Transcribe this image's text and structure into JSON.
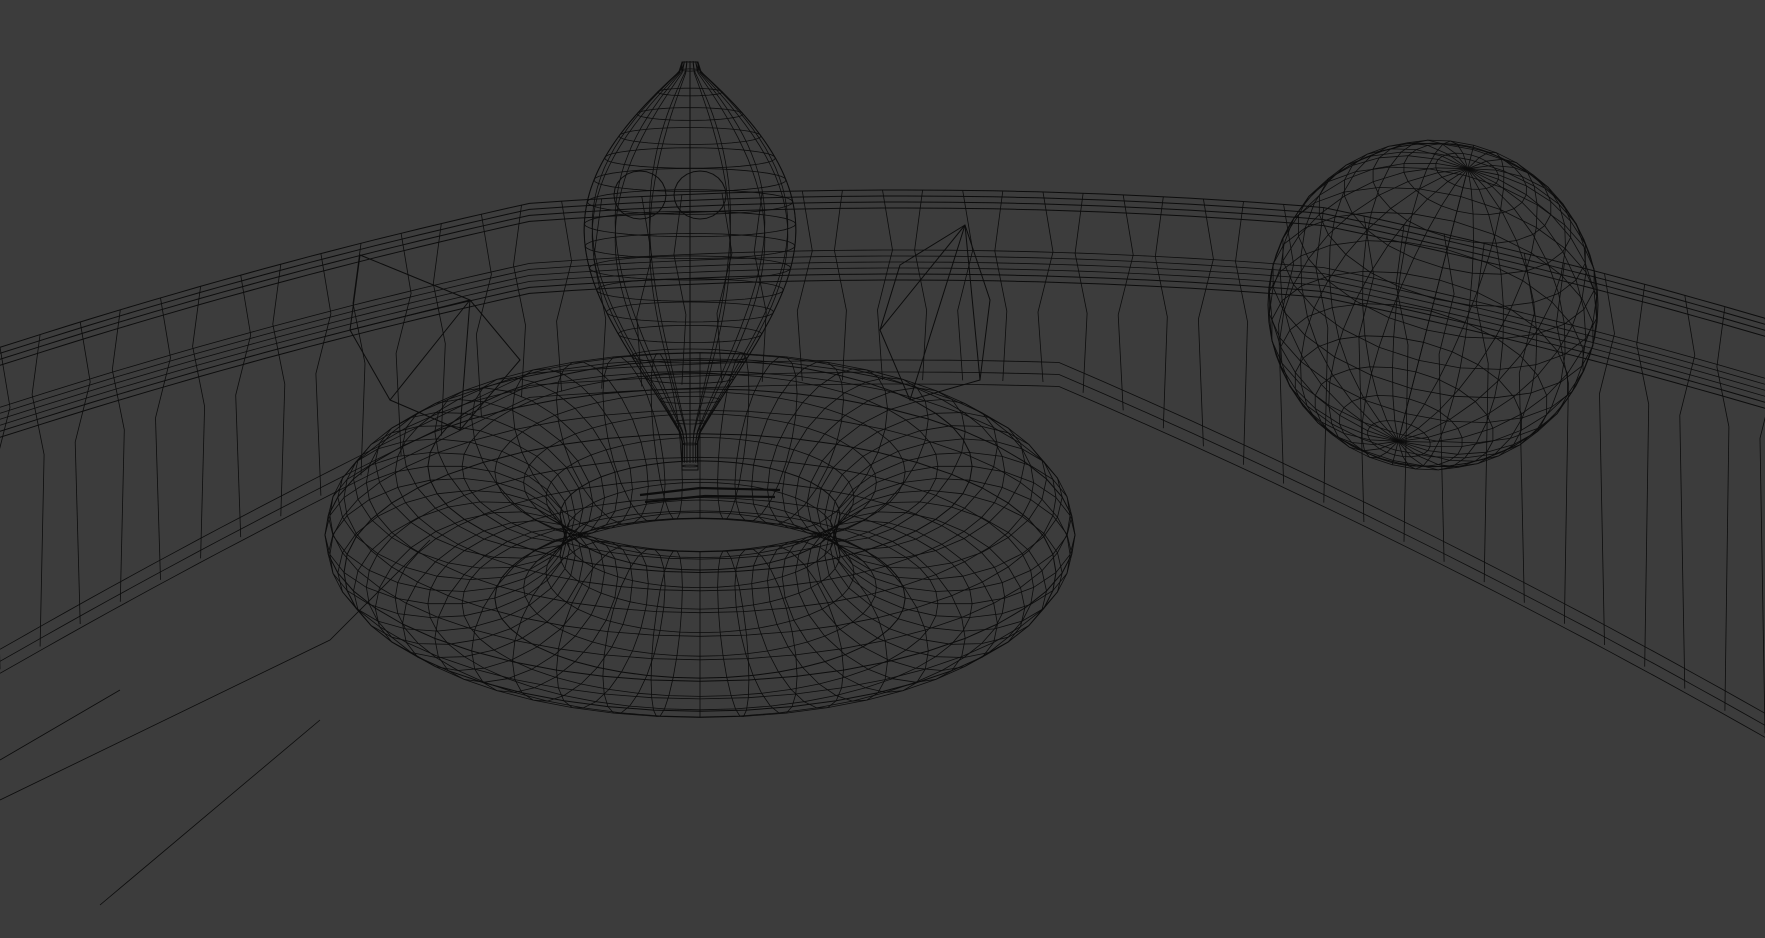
{
  "viewport": {
    "shading_mode": "wireframe",
    "background_color": "#3c3c3c",
    "wire_color": "#0c0c0c",
    "objects": [
      {
        "name": "curved-wall-ring",
        "shape": "curved segmented wall"
      },
      {
        "name": "torus",
        "shape": "torus"
      },
      {
        "name": "egg-capsule",
        "shape": "stretched sphere"
      },
      {
        "name": "uv-sphere",
        "shape": "uv sphere"
      },
      {
        "name": "cone-left",
        "shape": "cone"
      },
      {
        "name": "cone-right",
        "shape": "cone"
      },
      {
        "name": "ground-plane",
        "shape": "plane"
      }
    ]
  }
}
